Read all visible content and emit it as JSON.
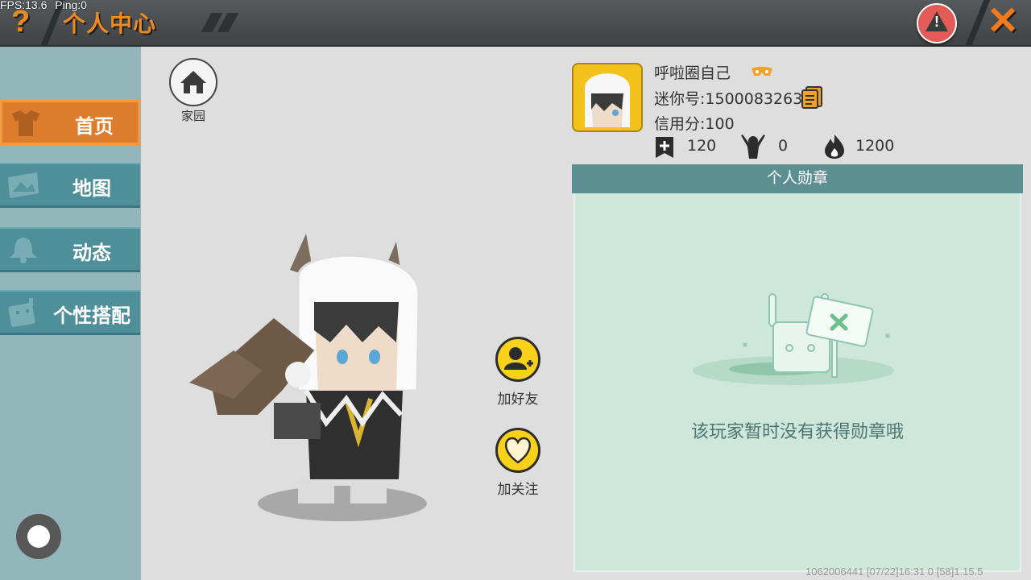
{
  "debug": {
    "fps": "FPS:13.6",
    "ping": "Ping:0"
  },
  "header": {
    "help_glyph": "?",
    "title": "个人中心",
    "close_glyph": "✕",
    "warning_glyph": "!"
  },
  "sidebar": {
    "items": [
      {
        "label": "首页",
        "icon": "shirt-icon",
        "active": true
      },
      {
        "label": "地图",
        "icon": "map-icon",
        "active": false
      },
      {
        "label": "动态",
        "icon": "bell-icon",
        "active": false
      },
      {
        "label": "个性搭配",
        "icon": "robot-icon",
        "active": false
      }
    ]
  },
  "home": {
    "label": "家园"
  },
  "profile": {
    "name": "呼啦圈自己",
    "mini_id": "迷你号:1500083263",
    "credit": "信用分:100",
    "stats": [
      {
        "icon": "plus-flag-icon",
        "value": "120"
      },
      {
        "icon": "cheer-icon",
        "value": "0"
      },
      {
        "icon": "flame-icon",
        "value": "1200"
      }
    ]
  },
  "actions": {
    "add_friend": "加好友",
    "follow": "加关注"
  },
  "badges": {
    "header": "个人勋章",
    "empty_text": "该玩家暂时没有获得勋章哦"
  },
  "footer": {
    "info": "1062006441   [07/22]16:31 0  [58]1.15.5"
  },
  "colors": {
    "accent_orange": "#f08a1f",
    "nav_teal": "#4e8f9a",
    "badge_bg": "#cde7db",
    "yellow": "#f8d11a"
  }
}
